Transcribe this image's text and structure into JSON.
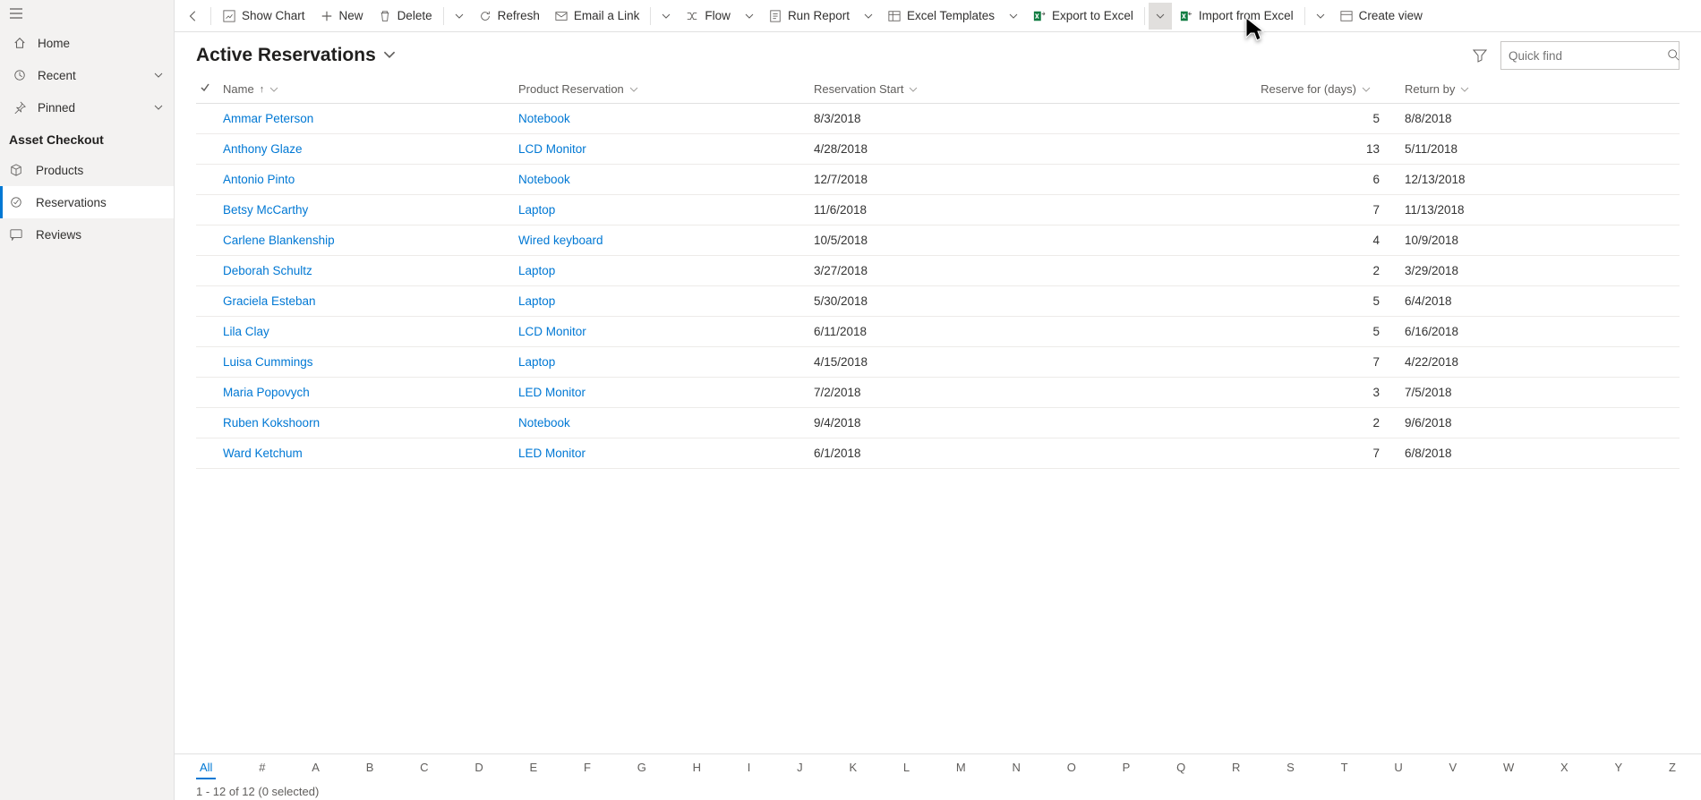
{
  "sidebar": {
    "nav": [
      {
        "icon": "home",
        "label": "Home"
      },
      {
        "icon": "clock",
        "label": "Recent",
        "chev": true
      },
      {
        "icon": "pin",
        "label": "Pinned",
        "chev": true
      }
    ],
    "section_title": "Asset Checkout",
    "area": [
      {
        "icon": "cube",
        "label": "Products"
      },
      {
        "icon": "check-circle",
        "label": "Reservations",
        "active": true
      },
      {
        "icon": "chat",
        "label": "Reviews"
      }
    ]
  },
  "commands": {
    "show_chart": "Show Chart",
    "new_label": "New",
    "delete_label": "Delete",
    "refresh": "Refresh",
    "email_link": "Email a Link",
    "flow": "Flow",
    "run_report": "Run Report",
    "excel_templates": "Excel Templates",
    "export_excel": "Export to Excel",
    "import_excel": "Import from Excel",
    "create_view": "Create view"
  },
  "view": {
    "title": "Active Reservations",
    "search_placeholder": "Quick find"
  },
  "columns": {
    "name": "Name",
    "product": "Product Reservation",
    "start": "Reservation Start",
    "days": "Reserve for (days)",
    "returnby": "Return by"
  },
  "rows": [
    {
      "name": "Ammar Peterson",
      "product": "Notebook",
      "start": "8/3/2018",
      "days": "5",
      "returnby": "8/8/2018"
    },
    {
      "name": "Anthony Glaze",
      "product": "LCD Monitor",
      "start": "4/28/2018",
      "days": "13",
      "returnby": "5/11/2018"
    },
    {
      "name": "Antonio Pinto",
      "product": "Notebook",
      "start": "12/7/2018",
      "days": "6",
      "returnby": "12/13/2018"
    },
    {
      "name": "Betsy McCarthy",
      "product": "Laptop",
      "start": "11/6/2018",
      "days": "7",
      "returnby": "11/13/2018"
    },
    {
      "name": "Carlene Blankenship",
      "product": "Wired keyboard",
      "start": "10/5/2018",
      "days": "4",
      "returnby": "10/9/2018"
    },
    {
      "name": "Deborah Schultz",
      "product": "Laptop",
      "start": "3/27/2018",
      "days": "2",
      "returnby": "3/29/2018"
    },
    {
      "name": "Graciela Esteban",
      "product": "Laptop",
      "start": "5/30/2018",
      "days": "5",
      "returnby": "6/4/2018"
    },
    {
      "name": "Lila Clay",
      "product": "LCD Monitor",
      "start": "6/11/2018",
      "days": "5",
      "returnby": "6/16/2018"
    },
    {
      "name": "Luisa Cummings",
      "product": "Laptop",
      "start": "4/15/2018",
      "days": "7",
      "returnby": "4/22/2018"
    },
    {
      "name": "Maria Popovych",
      "product": "LED Monitor",
      "start": "7/2/2018",
      "days": "3",
      "returnby": "7/5/2018"
    },
    {
      "name": "Ruben Kokshoorn",
      "product": "Notebook",
      "start": "9/4/2018",
      "days": "2",
      "returnby": "9/6/2018"
    },
    {
      "name": "Ward Ketchum",
      "product": "LED Monitor",
      "start": "6/1/2018",
      "days": "7",
      "returnby": "6/8/2018"
    }
  ],
  "alpha": [
    "All",
    "#",
    "A",
    "B",
    "C",
    "D",
    "E",
    "F",
    "G",
    "H",
    "I",
    "J",
    "K",
    "L",
    "M",
    "N",
    "O",
    "P",
    "Q",
    "R",
    "S",
    "T",
    "U",
    "V",
    "W",
    "X",
    "Y",
    "Z"
  ],
  "status": "1 - 12 of 12 (0 selected)"
}
